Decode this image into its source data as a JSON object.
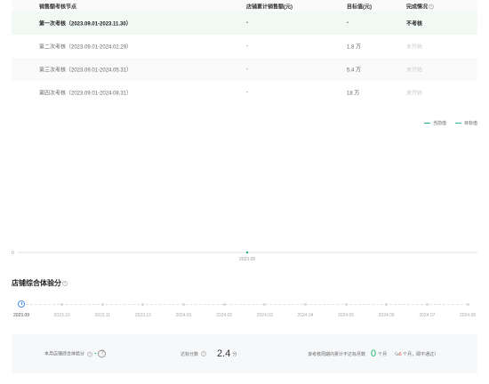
{
  "table": {
    "headers": [
      "销售额考核节点",
      "店铺累计销售额(元)",
      "目标值(元)",
      "完成情况"
    ],
    "rows": [
      {
        "node": "第一次考核（2023.09.01-2023.11.30）",
        "sales": "-",
        "target": "-",
        "status": "不考核",
        "highlight": true
      },
      {
        "node": "第二次考核（2023.09.01-2024.02.29）",
        "sales": "-",
        "target": "1.8 万",
        "status": "未开始"
      },
      {
        "node": "第三次考核（2023.09.01-2024.05.31）",
        "sales": "-",
        "target": "5.4 万",
        "status": "未开始"
      },
      {
        "node": "第四次考核（2023.09.01-2024.08.31）",
        "sales": "-",
        "target": "18 万",
        "status": "未开始"
      }
    ]
  },
  "legend": [
    {
      "label": "当前值",
      "color": "#1fb86b"
    },
    {
      "label": "目标值",
      "color": "#2bb3a0"
    }
  ],
  "chart_data": {
    "type": "line",
    "x": [
      "2023.09"
    ],
    "series": [
      {
        "name": "当前值",
        "values": [
          0
        ]
      },
      {
        "name": "目标值",
        "values": [
          0
        ]
      }
    ],
    "ytick_labels": [
      "0"
    ],
    "xtick_labels": [
      "2023.09"
    ]
  },
  "section": {
    "title": "店铺综合体验分"
  },
  "timeline": {
    "items": [
      "2023.09",
      "2023.10",
      "2023.11",
      "2023.12",
      "2024.01",
      "2024.02",
      "2024.03",
      "2024.04",
      "2024.05",
      "2024.06",
      "2024.07",
      "2024.08"
    ],
    "active_index": 0
  },
  "summary": {
    "score_label": "本月店铺综合体验分",
    "score_value": "-",
    "help_glyph": "?",
    "pass_label": "达标分数",
    "pass_value": "2.4",
    "pass_unit": "分",
    "months_label": "该考核周期内累计不达标月数",
    "months_value": "0",
    "months_unit": "个月",
    "months_note_prefix": "（≥",
    "months_note_red": "6",
    "months_note_suffix": " 个月，即不通过）"
  }
}
